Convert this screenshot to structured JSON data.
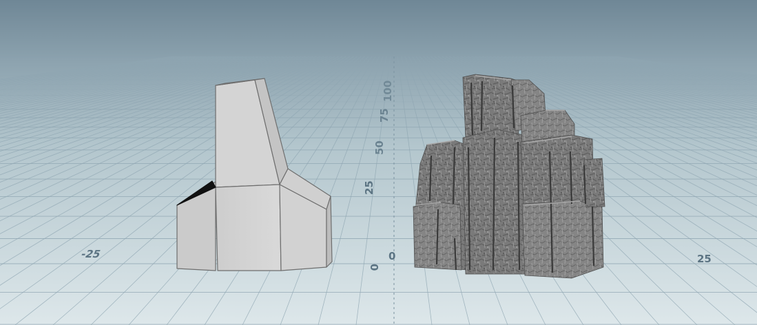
{
  "viewport": {
    "background_top": "#6e8695",
    "background_horizon": "#a7bdc6",
    "floor_near": "#dbe6ea",
    "grid_color": "#8fa6b2",
    "label_color": "#5c7483"
  },
  "axis_labels": {
    "x_negative": "-25",
    "x_origin": "0",
    "x_positive": "25",
    "z_origin": "0",
    "z_25": "25",
    "z_50": "50",
    "z_75": "75",
    "z_100": "100"
  },
  "objects": [
    {
      "name": "low-poly-blockout",
      "color": "#cfcfcf"
    },
    {
      "name": "sculpted-rock",
      "color": "#7d7d7d"
    }
  ]
}
